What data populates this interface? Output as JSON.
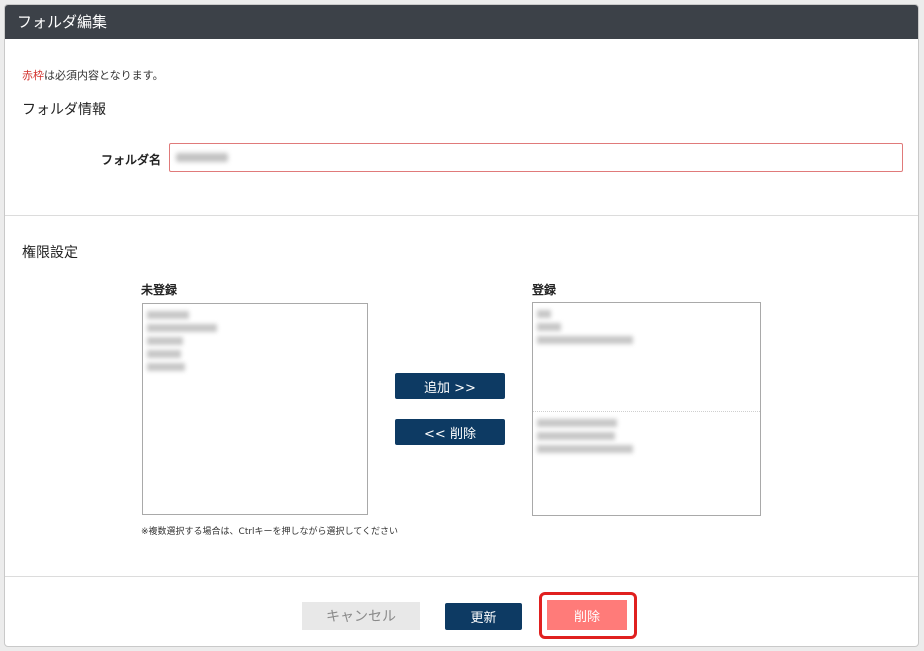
{
  "dialog": {
    "title": "フォルダ編集"
  },
  "form": {
    "required_note_red": "赤枠",
    "required_note_rest": "は必須内容となります。",
    "folder_info_title": "フォルダ情報",
    "folder_name_label": "フォルダ名",
    "folder_name_value": ""
  },
  "permissions": {
    "title": "権限設定",
    "unregistered_label": "未登録",
    "registered_label": "登録",
    "unregistered_items": [
      "",
      "",
      "",
      "",
      ""
    ],
    "registered_group1": [
      "",
      "",
      ""
    ],
    "registered_group2": [
      "",
      "",
      ""
    ],
    "add_button": "追加 >>",
    "remove_button": "<< 削除",
    "hint": "※複数選択する場合は、Ctrlキーを押しながら選択してください"
  },
  "footer": {
    "cancel_label": "キャンセル",
    "update_label": "更新",
    "delete_label": "削除"
  },
  "colors": {
    "titlebar": "#3c4148",
    "navy_button": "#0d3a63",
    "delete_button": "#ff7b79",
    "highlight_border": "#e0201f",
    "required_red": "#d2322d"
  }
}
